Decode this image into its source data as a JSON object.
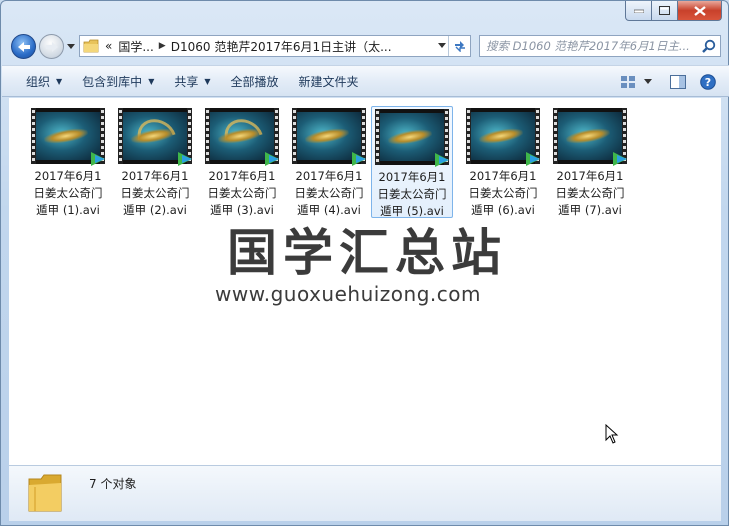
{
  "window": {
    "breadcrumb": [
      "«",
      "国学...",
      "D1060 范艳芹2017年6月1日主讲（太..."
    ],
    "search_placeholder": "搜索 D1060 范艳芹2017年6月1日主..."
  },
  "toolbar": {
    "organize": "组织",
    "include_in_library": "包含到库中",
    "share": "共享",
    "play_all": "全部播放",
    "new_folder": "新建文件夹"
  },
  "files": [
    {
      "line1": "2017年6月1",
      "line2": "日姜太公奇门",
      "line3": "遁甲 (1).avi"
    },
    {
      "line1": "2017年6月1",
      "line2": "日姜太公奇门",
      "line3": "遁甲 (2).avi"
    },
    {
      "line1": "2017年6月1",
      "line2": "日姜太公奇门",
      "line3": "遁甲 (3).avi"
    },
    {
      "line1": "2017年6月1",
      "line2": "日姜太公奇门",
      "line3": "遁甲 (4).avi"
    },
    {
      "line1": "2017年6月1",
      "line2": "日姜太公奇门",
      "line3": "遁甲 (5).avi"
    },
    {
      "line1": "2017年6月1",
      "line2": "日姜太公奇门",
      "line3": "遁甲 (6).avi"
    },
    {
      "line1": "2017年6月1",
      "line2": "日姜太公奇门",
      "line3": "遁甲 (7).avi"
    }
  ],
  "watermark": {
    "title": "国学汇总站",
    "url": "www.guoxuehuizong.com"
  },
  "status": {
    "count": "7 个对象"
  },
  "colors": {
    "selection_border": "#7eb4ea",
    "play_badge_green": "#3fb64a",
    "play_badge_blue": "#2aa0e0"
  }
}
